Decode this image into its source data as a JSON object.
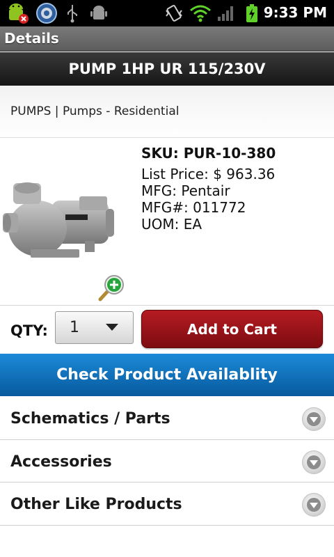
{
  "status_bar": {
    "time": "9:33 PM",
    "icons": [
      "android-notification-icon",
      "settings-app-icon",
      "usb-icon",
      "android-debug-icon",
      "vibrate-icon",
      "wifi-icon",
      "signal-icon",
      "battery-charging-icon"
    ]
  },
  "app_bar": {
    "title": "Details"
  },
  "product": {
    "name": "PUMP 1HP UR 115/230V",
    "category_path": "PUMPS | Pumps - Residential",
    "sku": "SKU: PUR-10-380",
    "list_price": "List Price: $ 963.36",
    "mfg": "MFG: Pentair",
    "mfg_number": "MFG#: 011772",
    "uom": "UOM: EA"
  },
  "order": {
    "qty_label": "QTY:",
    "qty_value": "1",
    "add_to_cart_label": "Add to Cart"
  },
  "availability_button": "Check Product Availablity",
  "sections": [
    {
      "label": "Schematics / Parts"
    },
    {
      "label": "Accessories"
    },
    {
      "label": "Other Like Products"
    }
  ],
  "colors": {
    "add_to_cart": "#9b1418",
    "availability": "#0f72bd",
    "header_dark": "#222222",
    "title_bar": "#6b6b6b"
  }
}
